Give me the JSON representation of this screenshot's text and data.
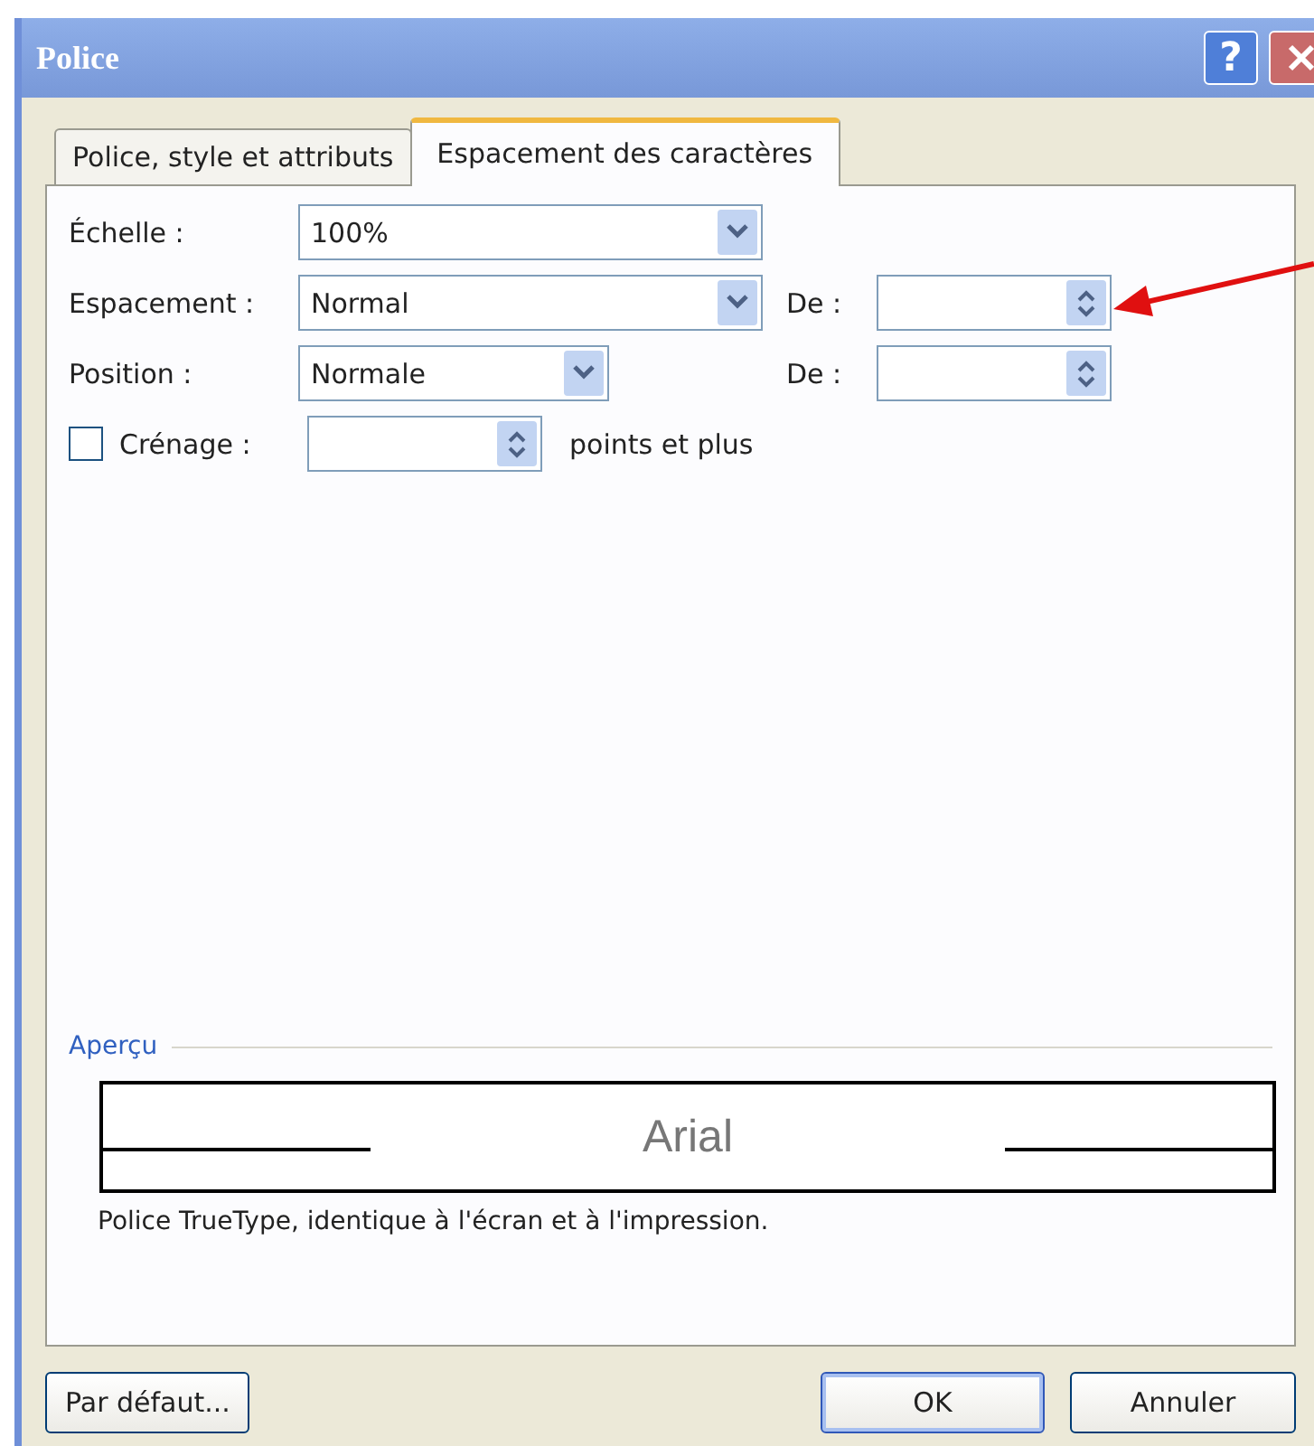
{
  "window": {
    "title": "Police",
    "help": "?"
  },
  "tabs": [
    {
      "label": "Police, style et attributs",
      "selected": false
    },
    {
      "label": "Espacement des caractères",
      "selected": true
    }
  ],
  "scale": {
    "label": "Échelle :",
    "value": "100%"
  },
  "spacing": {
    "label": "Espacement :",
    "value": "Normal",
    "by": {
      "label": "De :"
    }
  },
  "position": {
    "label": "Position :",
    "value": "Normale",
    "by": {
      "label": "De :"
    }
  },
  "kerning": {
    "label": "Crénage :",
    "checked": false,
    "suffix": "points et plus"
  },
  "preview": {
    "legend": "Aperçu",
    "sample": "Arial",
    "description": "Police TrueType, identique à l'écran et à l'impression."
  },
  "buttons": [
    {
      "label": "Par défaut...",
      "kind": "default"
    },
    {
      "label": "OK",
      "kind": "ok"
    },
    {
      "label": "Annuler",
      "kind": "cancel"
    }
  ]
}
